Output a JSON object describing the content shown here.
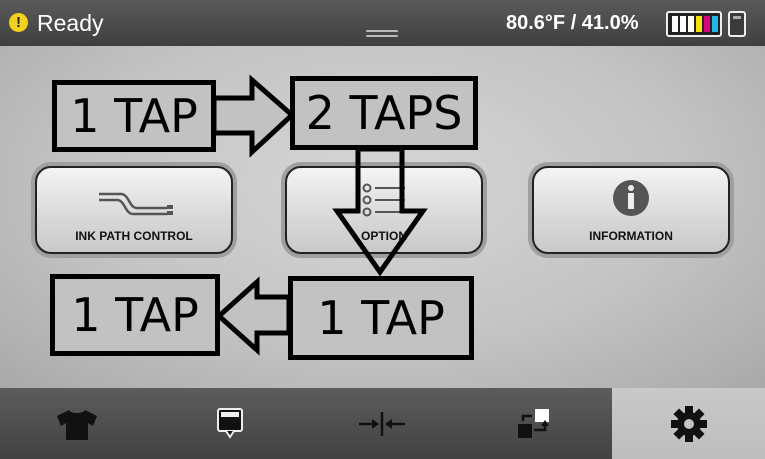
{
  "status": {
    "state": "Ready",
    "environment": "80.6°F / 41.0%",
    "ink_colors": [
      "#ffffff",
      "#ffffff",
      "#ffffff",
      "#f5e400",
      "#e0007a",
      "#1fb6e8"
    ]
  },
  "menu": {
    "ink_path_label": "INK PATH CONTROL",
    "option_label": "OPTION",
    "information_label": "INFORMATION"
  },
  "annotations": {
    "step1": "1 TAP",
    "step2": "2 TAPS",
    "step3": "1 TAP",
    "step4": "1 TAP"
  },
  "navbar": {
    "items": [
      "shirt-icon",
      "printhead-icon",
      "align-icon",
      "transfer-icon"
    ],
    "active": "gear-icon"
  }
}
